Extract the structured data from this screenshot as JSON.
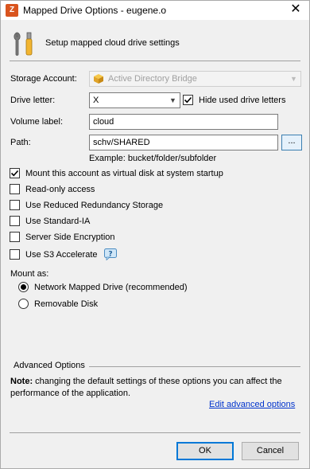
{
  "window": {
    "title": "Mapped Drive Options - eugene.o",
    "close_glyph": "✕"
  },
  "header": {
    "text": "Setup mapped cloud drive settings",
    "icon": "tools-icon"
  },
  "form": {
    "storage_account_label": "Storage Account:",
    "storage_account_value": "Active Directory Bridge",
    "drive_letter_label": "Drive letter:",
    "drive_letter_value": "X",
    "hide_used_label": "Hide used drive letters",
    "hide_used_checked": true,
    "volume_label_label": "Volume label:",
    "volume_label_value": "cloud",
    "path_label": "Path:",
    "path_value": "schv/SHARED",
    "browse_label": "...",
    "path_example": "Example: bucket/folder/subfolder"
  },
  "options": [
    {
      "label": "Mount this account as virtual disk at system startup",
      "checked": true
    },
    {
      "label": "Read-only access",
      "checked": false
    },
    {
      "label": "Use Reduced Redundancy Storage",
      "checked": false
    },
    {
      "label": "Use Standard-IA",
      "checked": false
    },
    {
      "label": "Server Side Encryption",
      "checked": false
    },
    {
      "label": "Use S3 Accelerate",
      "checked": false
    }
  ],
  "mount_as": {
    "label": "Mount as:",
    "choices": [
      {
        "label": "Network Mapped Drive (recommended)",
        "selected": true
      },
      {
        "label": "Removable Disk",
        "selected": false
      }
    ]
  },
  "advanced": {
    "title": "Advanced Options",
    "note_bold": "Note:",
    "note_text": "changing the default settings of these options you can affect the performance of the application.",
    "edit_link": "Edit advanced options"
  },
  "buttons": {
    "ok": "OK",
    "cancel": "Cancel"
  },
  "colors": {
    "accent": "#0078d7",
    "link": "#0033cc",
    "app_icon": "#d9541e"
  }
}
